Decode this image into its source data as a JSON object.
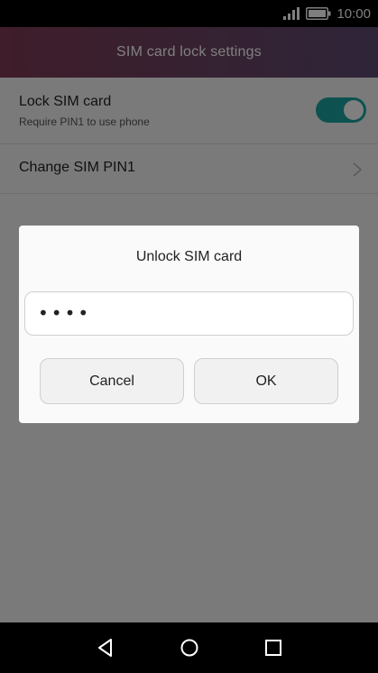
{
  "status_bar": {
    "time": "10:00",
    "signal_icon": "signal-icon",
    "battery_icon": "battery-icon"
  },
  "header": {
    "title": "SIM card lock settings"
  },
  "settings": {
    "lock_sim": {
      "label": "Lock SIM card",
      "sublabel": "Require PIN1 to use phone",
      "enabled": true
    },
    "change_pin": {
      "label": "Change SIM PIN1"
    }
  },
  "dialog": {
    "title": "Unlock SIM card",
    "pin_value": "••••",
    "cancel_label": "Cancel",
    "ok_label": "OK"
  },
  "nav_bar": {
    "back_icon": "back-icon",
    "home_icon": "home-icon",
    "recents_icon": "recents-icon"
  },
  "colors": {
    "accent": "#1aa5a0",
    "header_start": "#7f3a55",
    "header_end": "#5e4a73"
  }
}
